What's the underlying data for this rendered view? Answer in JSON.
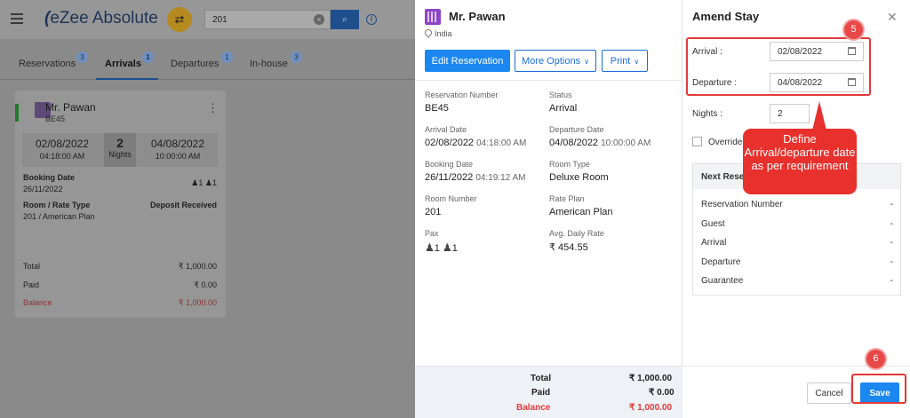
{
  "app": {
    "logo_text": "eZee Absolute",
    "search_value": "201"
  },
  "tabs": [
    {
      "label": "Reservations",
      "count": "3"
    },
    {
      "label": "Arrivals",
      "count": "1"
    },
    {
      "label": "Departures",
      "count": "1"
    },
    {
      "label": "In-house",
      "count": "3"
    }
  ],
  "card": {
    "guest_name": "Mr. Pawan",
    "code": "BE45",
    "arrival_date": "02/08/2022",
    "arrival_time": "04:18:00 AM",
    "nights": "2",
    "nights_label": "Nights",
    "departure_date": "04/08/2022",
    "departure_time": "10:00:00 AM",
    "booking_date_label": "Booking Date",
    "booking_date": "26/11/2022",
    "pax_adults": "1",
    "pax_children": "1",
    "room_rate_label": "Room / Rate Type",
    "room_rate": "201 / American Plan",
    "deposit_status": "Deposit Received",
    "total_label": "Total",
    "total": "₹ 1,000.00",
    "paid_label": "Paid",
    "paid": "₹ 0.00",
    "balance_label": "Balance",
    "balance": "₹ 1,000.00"
  },
  "detail": {
    "guest_name": "Mr. Pawan",
    "country": "India",
    "edit_label": "Edit Reservation",
    "more_label": "More Options",
    "print_label": "Print",
    "fields": {
      "res_no_label": "Reservation Number",
      "res_no": "BE45",
      "status_label": "Status",
      "status": "Arrival",
      "arr_label": "Arrival Date",
      "arr_date": "02/08/2022",
      "arr_time": "04:18:00 AM",
      "dep_label": "Departure Date",
      "dep_date": "04/08/2022",
      "dep_time": "10:00:00 AM",
      "book_label": "Booking Date",
      "book_date": "26/11/2022",
      "book_time": "04:19:12 AM",
      "room_type_label": "Room Type",
      "room_type": "Deluxe Room",
      "room_no_label": "Room Number",
      "room_no": "201",
      "rate_plan_label": "Rate Plan",
      "rate_plan": "American Plan",
      "pax_label": "Pax",
      "pax_adults": "1",
      "pax_children": "1",
      "adr_label": "Avg. Daily Rate",
      "adr": "₹ 454.55"
    },
    "total_label": "Total",
    "total": "₹ 1,000.00",
    "paid_label": "Paid",
    "paid": "₹ 0.00",
    "balance_label": "Balance",
    "balance": "₹ 1,000.00"
  },
  "amend": {
    "title": "Amend Stay",
    "arrival_label": "Arrival :",
    "arrival_value": "02/08/2022",
    "departure_label": "Departure :",
    "departure_value": "04/08/2022",
    "nights_label": "Nights :",
    "nights_value": "2",
    "override_label": "Override",
    "next_header": "Next Reser",
    "next_rows": [
      {
        "label": "Reservation Number",
        "value": "-"
      },
      {
        "label": "Guest",
        "value": "-"
      },
      {
        "label": "Arrival",
        "value": "-"
      },
      {
        "label": "Departure",
        "value": "-"
      },
      {
        "label": "Guarantee",
        "value": "-"
      }
    ],
    "cancel_label": "Cancel",
    "save_label": "Save"
  },
  "annotations": {
    "step5": "5",
    "step6": "6",
    "callout_text": "Define Arrival/departure date as per requirement",
    "highlight_color": "#e23a3a"
  },
  "colors": {
    "primary": "#1b87f0",
    "alert_red": "#e23a3a",
    "avatar_purple": "#8e44c7"
  }
}
